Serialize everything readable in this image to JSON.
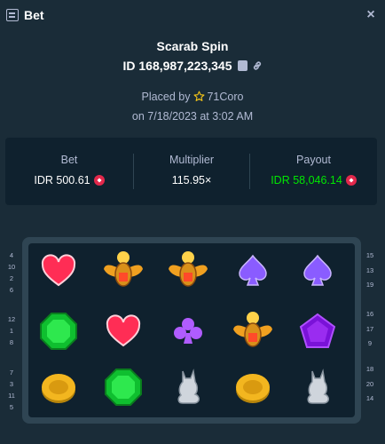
{
  "header": {
    "title": "Bet",
    "close_glyph": "×"
  },
  "game": {
    "name": "Scarab Spin",
    "id_text": "ID 168,987,223,345"
  },
  "placed": {
    "prefix": "Placed by",
    "user": "71Coro",
    "date": "on 7/18/2023 at 3:02 AM"
  },
  "stats": {
    "bet_label": "Bet",
    "bet_value": "IDR 500.61",
    "multiplier_label": "Multiplier",
    "multiplier_value": "115.95×",
    "payout_label": "Payout",
    "payout_value": "IDR 58,046.14"
  },
  "colors": {
    "background": "#1a2c38",
    "panel": "#0f212e",
    "frame": "#2f4553",
    "payout_green": "#00e701",
    "coin_red": "#e2284b"
  },
  "paylines": {
    "left": [
      "4",
      "10",
      "2",
      "6",
      "12",
      "1",
      "8",
      "7",
      "3",
      "11",
      "5"
    ],
    "right": [
      "15",
      "13",
      "19",
      "16",
      "17",
      "9",
      "18",
      "20",
      "14"
    ]
  },
  "reels": [
    [
      "heart-icon",
      "scarab-icon",
      "scarab-icon",
      "spade-icon",
      "spade-icon"
    ],
    [
      "emerald-icon",
      "heart-icon",
      "club-icon",
      "scarab-icon",
      "pentagon-gem-icon"
    ],
    [
      "gold-coin-icon",
      "emerald-icon",
      "cat-statue-icon",
      "gold-coin-icon",
      "cat-statue-icon"
    ]
  ]
}
